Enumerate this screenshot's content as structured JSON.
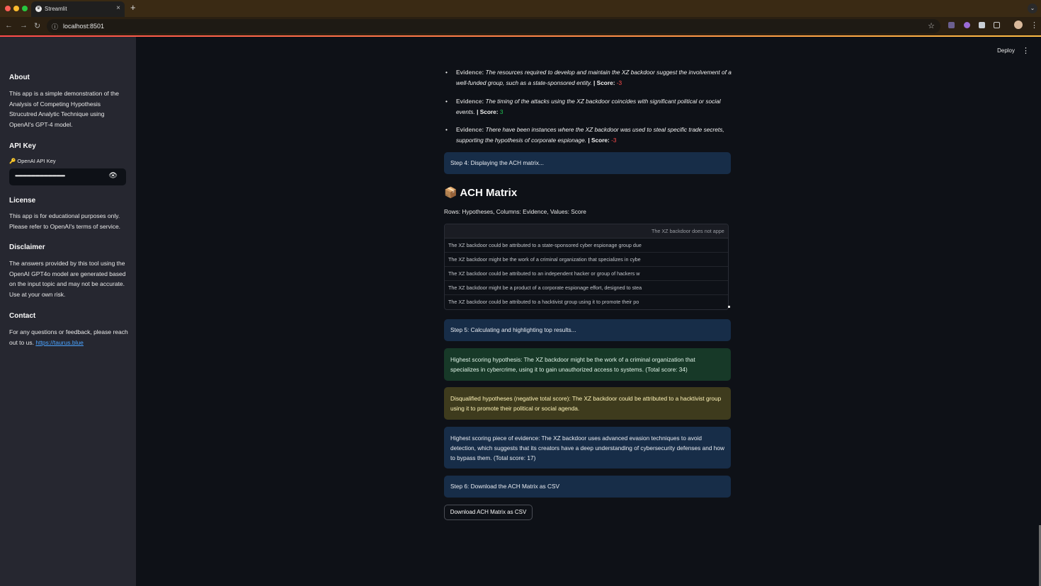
{
  "browser": {
    "tab_title": "Streamlit",
    "tab_favicon": "streamlit-crown-icon",
    "url": "localhost:8501",
    "colors": {
      "close": "#ff5f57",
      "minimize": "#febc2e",
      "maximize": "#28c840"
    }
  },
  "sidebar": {
    "about_heading": "About",
    "about_text": "This app is a simple demonstration of the Analysis of Competing Hypothesis Strucutred Analytic Technique using OpenAI's GPT-4 model.",
    "api_heading": "API Key",
    "api_label": "🔑 OpenAI API Key",
    "api_value": "••••••••••••••••••••••••••••••••••••••••••••••••••••••••••",
    "license_heading": "License",
    "license_text": "This app is for educational purposes only. Please refer to OpenAI's terms of service.",
    "disclaimer_heading": "Disclaimer",
    "disclaimer_text": "The answers provided by this tool using the OpenAI GPT4o model are generated based on the input topic and may not be accurate. Use at your own risk.",
    "contact_heading": "Contact",
    "contact_text": "For any questions or feedback, please reach out to us.",
    "contact_link": "https://taurus.blue"
  },
  "header": {
    "deploy_label": "Deploy"
  },
  "evidence": [
    {
      "label": "Evidence:",
      "text": "The resources required to develop and maintain the XZ backdoor suggest the involvement of a well-funded group, such as a state-sponsored entity.",
      "score_label": "| Score:",
      "score": "-3",
      "score_color": "#ff4b4b"
    },
    {
      "label": "Evidence:",
      "text": "The timing of the attacks using the XZ backdoor coincides with significant political or social events.",
      "score_label": "| Score:",
      "score": "3",
      "score_color": "#21c354"
    },
    {
      "label": "Evidence:",
      "text": "There have been instances where the XZ backdoor was used to steal specific trade secrets, supporting the hypothesis of corporate espionage.",
      "score_label": "| Score:",
      "score": "-3",
      "score_color": "#ff4b4b"
    }
  ],
  "steps": {
    "step4": "Step 4: Displaying the ACH matrix...",
    "step5": "Step 5: Calculating and highlighting top results...",
    "step6": "Step 6: Download the ACH Matrix as CSV"
  },
  "matrix": {
    "title": "ACH Matrix",
    "title_icon": "📦",
    "caption": "Rows: Hypotheses, Columns: Evidence, Values: Score",
    "column_header": "The XZ backdoor does not appe",
    "rows": [
      "The XZ backdoor could be attributed to a state-sponsored cyber espionage group due",
      "The XZ backdoor might be the work of a criminal organization that specializes in cybe",
      "The XZ backdoor could be attributed to an independent hacker or group of hackers w",
      "The XZ backdoor might be a product of a corporate espionage effort, designed to stea",
      "The XZ backdoor could be attributed to a hacktivist group using it to promote their po"
    ]
  },
  "results": {
    "highest_hypothesis": "Highest scoring hypothesis: The XZ backdoor might be the work of a criminal organization that specializes in cybercrime, using it to gain unauthorized access to systems. (Total score: 34)",
    "disqualified": "Disqualified hypotheses (negative total score): The XZ backdoor could be attributed to a hacktivist group using it to promote their political or social agenda.",
    "highest_evidence": "Highest scoring piece of evidence: The XZ backdoor uses advanced evasion techniques to avoid detection, which suggests that its creators have a deep understanding of cybersecurity defenses and how to bypass them. (Total score: 17)"
  },
  "download_button": "Download ACH Matrix as CSV"
}
